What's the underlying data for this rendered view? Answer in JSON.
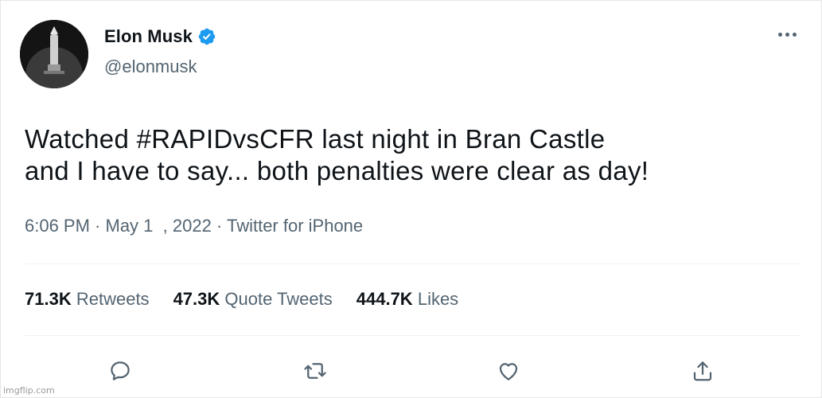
{
  "tweet": {
    "author": {
      "display_name": "Elon Musk",
      "handle": "@elonmusk",
      "verified": true
    },
    "text_line1": "Watched #RAPIDvsCFR last night in Bran Castle",
    "text_line2": "and I have to say... both penalties were clear as day!",
    "meta": {
      "time": "6:06 PM",
      "separator": " · ",
      "date": "May 1  , 2022",
      "separator2": " · ",
      "source": "Twitter for iPhone"
    },
    "stats": [
      {
        "count": "71.3K",
        "label": "Retweets"
      },
      {
        "count": "47.3K",
        "label": "Quote Tweets"
      },
      {
        "count": "444.7K",
        "label": "Likes"
      }
    ]
  },
  "icons": {
    "more": "more-options-icon",
    "reply": "reply-icon",
    "retweet": "retweet-icon",
    "like": "like-icon",
    "share": "share-icon",
    "verified": "verified-badge-icon"
  },
  "colors": {
    "text_primary": "#0f1419",
    "text_secondary": "#536471",
    "verified_blue": "#1d9bf0",
    "divider": "#eff3f4"
  },
  "watermark": "imgflip.com"
}
